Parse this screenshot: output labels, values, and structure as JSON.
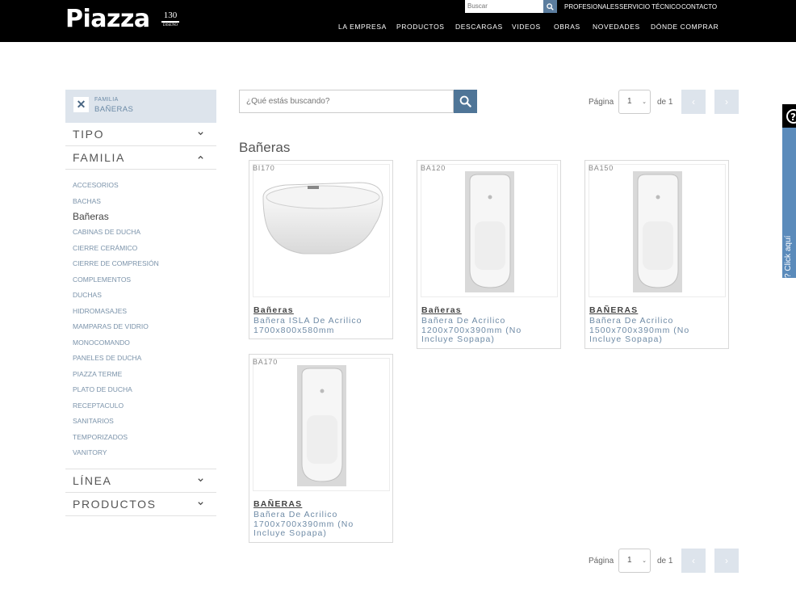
{
  "header": {
    "logo_text": "Piazza",
    "logo_badge_num": "130",
    "logo_badge_sub": "DISEÑO",
    "search_placeholder": "Buscar",
    "top_links": [
      "PROFESIONALES",
      "SERVICIO TÉCNICO",
      "CONTACTO"
    ],
    "nav": [
      "LA EMPRESA",
      "PRODUCTOS",
      "DESCARGAS",
      "VIDEOS",
      "OBRAS",
      "NOVEDADES",
      "DÓNDE COMPRAR"
    ]
  },
  "sidebar": {
    "filter_chip": {
      "label": "FAMILIA",
      "value": "BAÑERAS"
    },
    "accordions": {
      "tipo": "TIPO",
      "familia": "FAMILIA",
      "linea": "LÍNEA",
      "productos": "PRODUCTOS"
    },
    "familia_items": [
      "ACCESORIOS",
      "BACHAS",
      "Bañeras",
      "CABINAS DE DUCHA",
      "CIERRE CERÁMICO",
      "CIERRE DE COMPRESIÓN",
      "COMPLEMENTOS",
      "DUCHAS",
      "HIDROMASAJES",
      "MAMPARAS DE VIDRIO",
      "MONOCOMANDO",
      "PANELES DE DUCHA",
      "PIAZZA TERME",
      "PLATO DE DUCHA",
      "RECEPTACULO",
      "SANITARIOS",
      "TEMPORIZADOS",
      "VANITORY"
    ],
    "active_item": "Bañeras"
  },
  "search": {
    "placeholder": "¿Qué estás buscando?"
  },
  "pager": {
    "label": "Página",
    "page": "1",
    "of": "de 1",
    "prev": "‹",
    "next": "›"
  },
  "section_title": "Bañeras",
  "products": [
    {
      "code": "BI170",
      "name": "Bañeras",
      "desc": "Bañera ISLA De Acrilico 1700x800x580mm",
      "type": "freestanding"
    },
    {
      "code": "BA120",
      "name": "Bañeras",
      "desc": "Bañera De Acrilico 1200x700x390mm (No Incluye Sopapa)",
      "type": "built-in"
    },
    {
      "code": "BA150",
      "name": "BAÑERAS",
      "desc": "Bañera De Acrilico 1500x700x390mm (No Incluye Sopapa)",
      "type": "built-in"
    },
    {
      "code": "BA170",
      "name": "BAÑERAS",
      "desc": "Bañera De Acrilico 1700x700x390mm (No Incluye Sopapa)",
      "type": "built-in"
    }
  ],
  "help_tab": {
    "text": "¿Necesita ayuda? Click aquí"
  },
  "colors": {
    "accent": "#4f7597",
    "chip_bg": "#dde4ec",
    "link": "#7b93aa"
  }
}
